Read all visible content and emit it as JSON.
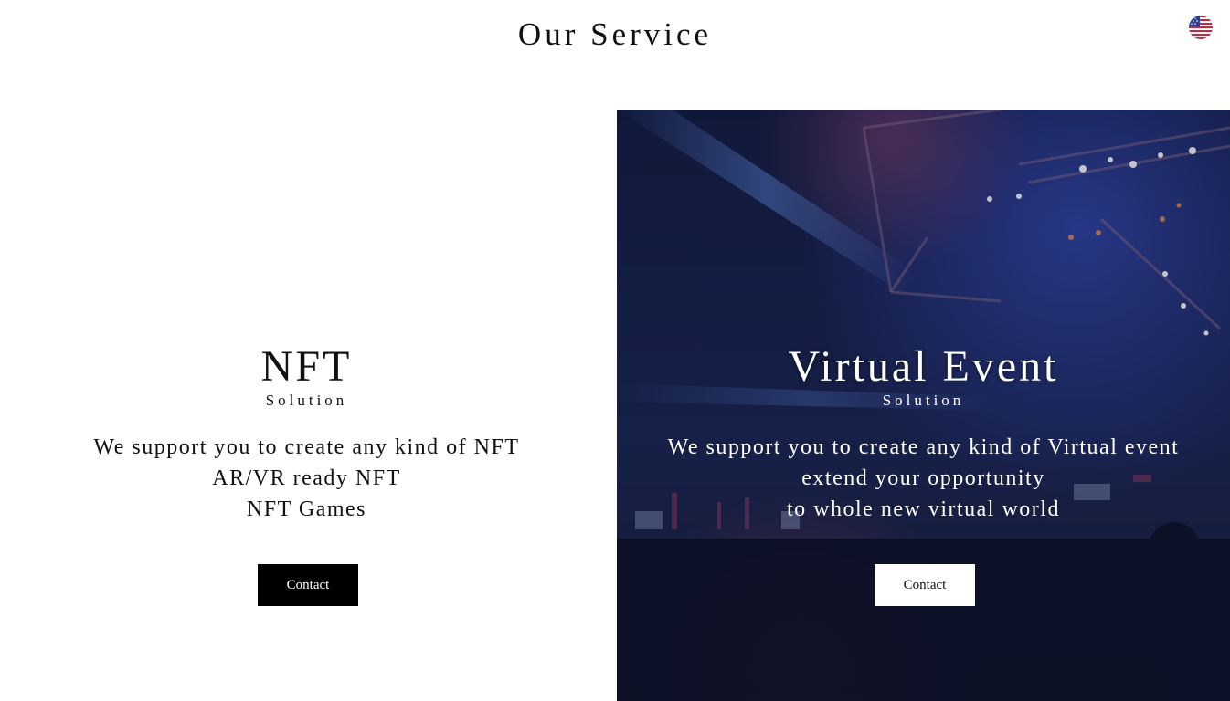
{
  "header": {
    "title": "Our Service",
    "language_icon": "us-flag-icon"
  },
  "services": [
    {
      "title": "NFT",
      "subtitle": "Solution",
      "lines": [
        "We support you to create any kind of NFT",
        "AR/VR ready NFT",
        "NFT Games"
      ],
      "button_label": "Contact"
    },
    {
      "title": "Virtual Event",
      "subtitle": "Solution",
      "lines": [
        "We support you to create any kind of Virtual event",
        "extend your opportunity",
        "to whole new virtual world"
      ],
      "button_label": "Contact"
    }
  ],
  "colors": {
    "dark_button": "#000000",
    "light_button": "#ffffff",
    "event_overlay": "#0f1a3a"
  }
}
